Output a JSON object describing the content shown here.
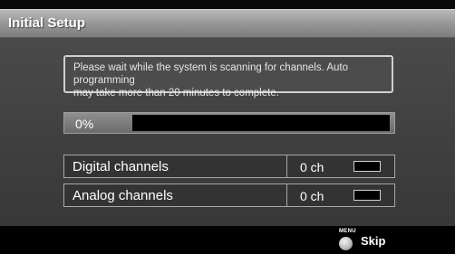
{
  "header": {
    "title": "Initial Setup"
  },
  "message": {
    "line1": "Please wait while the system is scanning for channels. Auto programming",
    "line2": "may take more than 20 minutes to complete."
  },
  "progress": {
    "label": "0%",
    "value": 0
  },
  "channels": [
    {
      "label": "Digital channels",
      "count": "0 ch"
    },
    {
      "label": "Analog channels",
      "count": "0 ch"
    }
  ],
  "footer": {
    "key_label": "MENU",
    "action_label": "Skip"
  }
}
